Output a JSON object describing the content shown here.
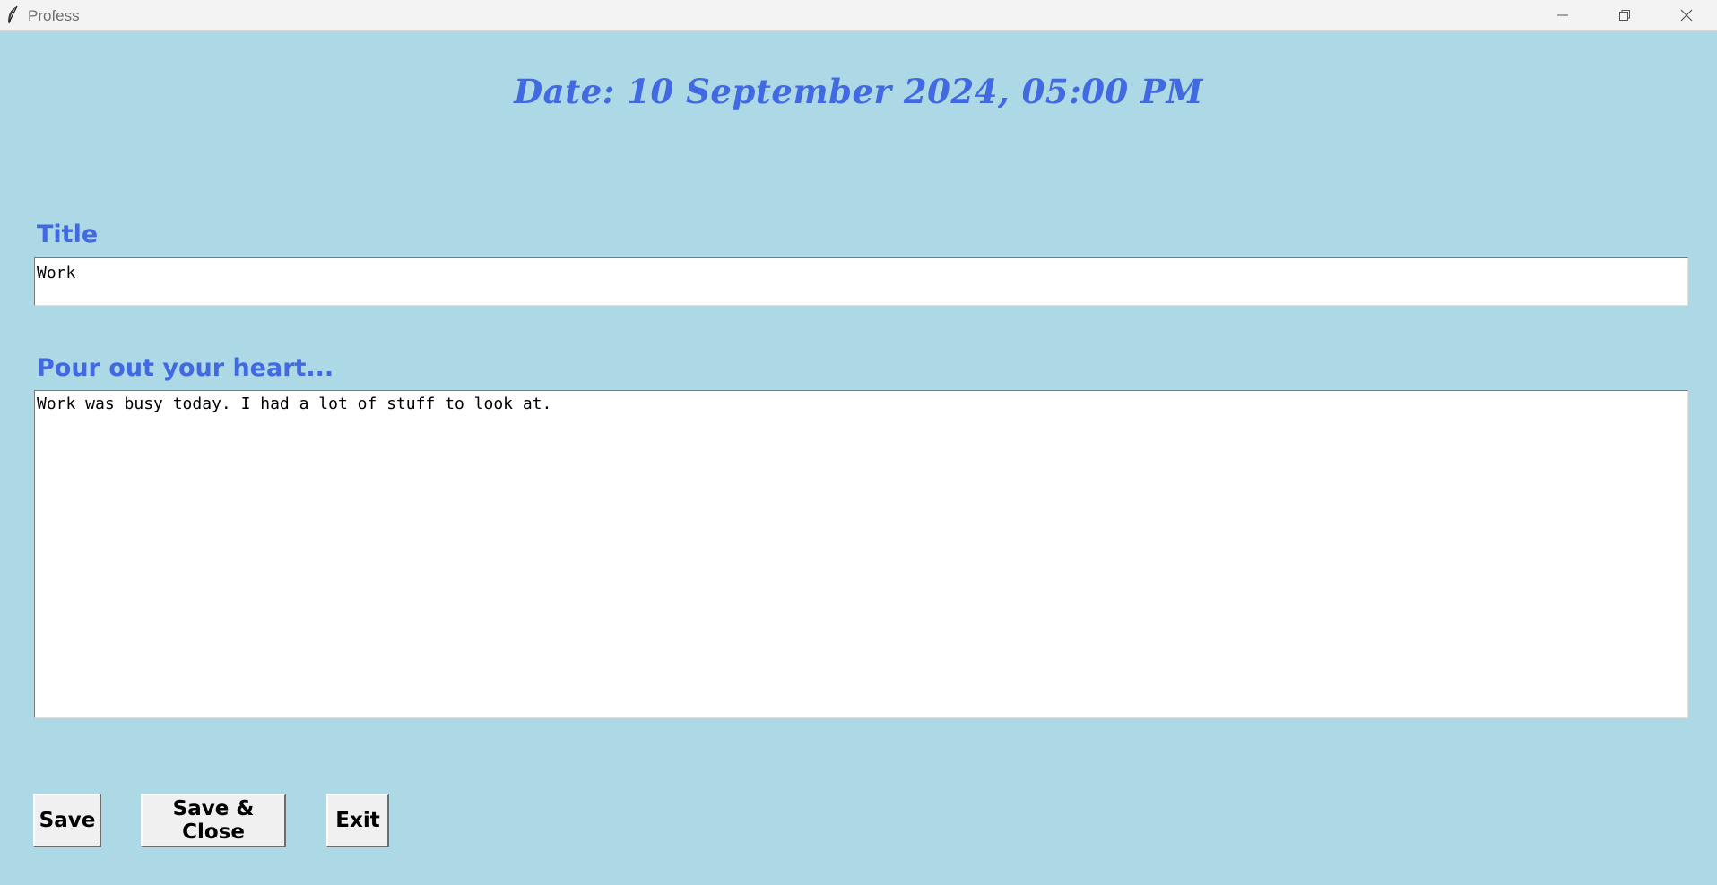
{
  "window": {
    "title": "Profess",
    "icons": {
      "app": "feather-icon",
      "minimize": "minimize-icon",
      "maximize": "restore-icon",
      "close": "close-icon"
    }
  },
  "header": {
    "date_text": "Date: 10 September 2024, 05:00 PM"
  },
  "form": {
    "title_label": "Title",
    "title_value": "Work",
    "body_label": "Pour out your heart...",
    "body_value": "Work was busy today. I had a lot of stuff to look at."
  },
  "buttons": {
    "save": "Save",
    "save_close": "Save & Close",
    "exit": "Exit"
  },
  "colors": {
    "background": "#add8e6",
    "accent": "#4169e1",
    "button_face": "#f0f0f0"
  }
}
